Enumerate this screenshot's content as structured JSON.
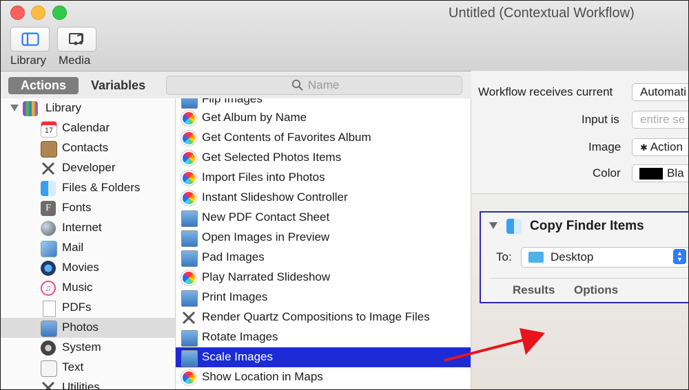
{
  "window": {
    "title": "Untitled (Contextual Workflow)"
  },
  "toolbar": {
    "library_label": "Library",
    "media_label": "Media"
  },
  "tabs": {
    "actions": "Actions",
    "variables": "Variables"
  },
  "search": {
    "placeholder": "Name"
  },
  "library": {
    "root": "Library",
    "items": [
      {
        "label": "Calendar",
        "icon": "calendar-icon"
      },
      {
        "label": "Contacts",
        "icon": "contacts-icon"
      },
      {
        "label": "Developer",
        "icon": "developer-icon"
      },
      {
        "label": "Files & Folders",
        "icon": "finder-icon"
      },
      {
        "label": "Fonts",
        "icon": "fonts-icon"
      },
      {
        "label": "Internet",
        "icon": "globe-icon"
      },
      {
        "label": "Mail",
        "icon": "mail-icon"
      },
      {
        "label": "Movies",
        "icon": "quicktime-icon"
      },
      {
        "label": "Music",
        "icon": "music-icon"
      },
      {
        "label": "PDFs",
        "icon": "pdf-icon"
      },
      {
        "label": "Photos",
        "icon": "photos-icon",
        "selected": true
      },
      {
        "label": "System",
        "icon": "system-icon"
      },
      {
        "label": "Text",
        "icon": "text-icon"
      },
      {
        "label": "Utilities",
        "icon": "utilities-icon"
      }
    ]
  },
  "actions": {
    "items": [
      {
        "label": "Flip Images",
        "icon": "preview-icon"
      },
      {
        "label": "Get Album by Name",
        "icon": "photos-icon"
      },
      {
        "label": "Get Contents of Favorites Album",
        "icon": "photos-icon"
      },
      {
        "label": "Get Selected Photos Items",
        "icon": "photos-icon"
      },
      {
        "label": "Import Files into Photos",
        "icon": "photos-icon"
      },
      {
        "label": "Instant Slideshow Controller",
        "icon": "photos-icon"
      },
      {
        "label": "New PDF Contact Sheet",
        "icon": "preview-icon"
      },
      {
        "label": "Open Images in Preview",
        "icon": "preview-icon"
      },
      {
        "label": "Pad Images",
        "icon": "preview-icon"
      },
      {
        "label": "Play Narrated Slideshow",
        "icon": "photos-icon"
      },
      {
        "label": "Print Images",
        "icon": "preview-icon"
      },
      {
        "label": "Render Quartz Compositions to Image Files",
        "icon": "tools-icon"
      },
      {
        "label": "Rotate Images",
        "icon": "preview-icon"
      },
      {
        "label": "Scale Images",
        "icon": "preview-icon",
        "selected": true
      },
      {
        "label": "Show Location in Maps",
        "icon": "photos-icon"
      }
    ]
  },
  "workflow": {
    "receives_label": "Workflow receives current",
    "receives_value": "Automati",
    "input_label": "Input is",
    "input_value": "entire se",
    "image_label": "Image",
    "image_value": "Action",
    "color_label": "Color",
    "color_value": "Bla",
    "color_swatch": "#000000"
  },
  "card": {
    "title": "Copy Finder Items",
    "to_label": "To:",
    "destination": "Desktop",
    "results": "Results",
    "options": "Options",
    "border_color": "#2a2ab5"
  },
  "colors": {
    "selection": "#1c2bd6",
    "arrow": "#e8141b"
  }
}
